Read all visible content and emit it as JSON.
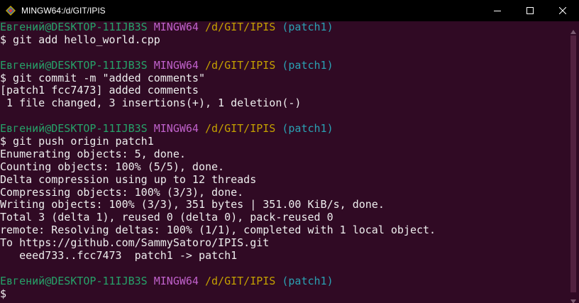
{
  "window": {
    "title": "MINGW64:/d/GIT/IPIS"
  },
  "colors": {
    "background": "#300a24",
    "user": "#26a269",
    "system": "#c061cb",
    "path": "#c4a000",
    "branch": "#2aa1b3",
    "text": "#eeeeee"
  },
  "icons": {
    "app": "mingw-icon",
    "minimize": "minimize-icon",
    "maximize": "maximize-icon",
    "close": "close-icon"
  },
  "prompt": {
    "user": "Евгений@DESKTOP-11IJB3S",
    "system": "MINGW64",
    "path": "/d/GIT/IPIS",
    "branch": "(patch1)"
  },
  "lines": [
    "$ git add hello_world.cpp",
    "",
    "$ git commit -m \"added comments\"",
    "[patch1 fcc7473] added comments",
    " 1 file changed, 3 insertions(+), 1 deletion(-)",
    "",
    "$ git push origin patch1",
    "Enumerating objects: 5, done.",
    "Counting objects: 100% (5/5), done.",
    "Delta compression using up to 12 threads",
    "Compressing objects: 100% (3/3), done.",
    "Writing objects: 100% (3/3), 351 bytes | 351.00 KiB/s, done.",
    "Total 3 (delta 1), reused 0 (delta 0), pack-reused 0",
    "remote: Resolving deltas: 100% (1/1), completed with 1 local object.",
    "To https://github.com/SammySatoro/IPIS.git",
    "   eeed733..fcc7473  patch1 -> patch1",
    "",
    "$"
  ]
}
